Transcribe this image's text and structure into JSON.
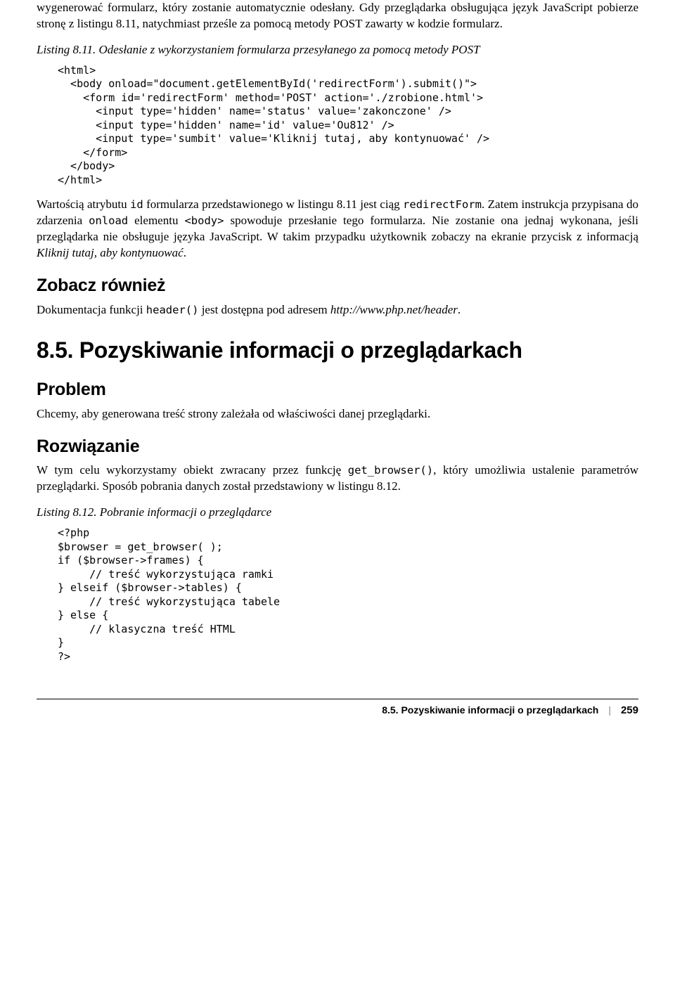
{
  "intro_para": "wygenerować formularz, który zostanie automatycznie odesłany. Gdy przeglądarka obsługująca język JavaScript pobierze stronę z listingu 8.11, natychmiast prześle za pomocą metody POST zawarty w kodzie formularz.",
  "listing_811_caption": "Listing 8.11. Odesłanie z wykorzystaniem formularza przesyłanego za pomocą metody POST",
  "listing_811_code": "<html>\n  <body onload=\"document.getElementById('redirectForm').submit()\">\n    <form id='redirectForm' method='POST' action='./zrobione.html'>\n      <input type='hidden' name='status' value='zakonczone' />\n      <input type='hidden' name='id' value='Ou812' />\n      <input type='sumbit' value='Kliknij tutaj, aby kontynuować' />\n    </form>\n  </body>\n</html>",
  "after_code_para": {
    "t1": "Wartością atrybutu ",
    "c1": "id",
    "t2": " formularza przedstawionego w listingu 8.11 jest ciąg ",
    "c2": "redirectForm",
    "t3": ". Zatem instrukcja przypisana do zdarzenia ",
    "c3": "onload",
    "t4": " elementu ",
    "c4": "<body>",
    "t5": " spowoduje przesłanie tego formularza. Nie zostanie ona jednaj wykonana, jeśli przeglądarka nie obsługuje języka JavaScript. W takim przypadku użytkownik zobaczy na ekranie przycisk z informacją ",
    "i1": "Kliknij tutaj, aby kontynuować",
    "t6": "."
  },
  "see_also_heading": "Zobacz również",
  "see_also_para": {
    "t1": "Dokumentacja funkcji ",
    "c1": "header()",
    "t2": " jest dostępna pod adresem ",
    "i1": "http://www.php.net/header",
    "t3": "."
  },
  "section_85_heading": "8.5. Pozyskiwanie informacji o przeglądarkach",
  "problem_heading": "Problem",
  "problem_para": "Chcemy, aby generowana treść strony zależała od właściwości danej przeglądarki.",
  "solution_heading": "Rozwiązanie",
  "solution_para": {
    "t1": "W tym celu wykorzystamy obiekt zwracany przez funkcję ",
    "c1": "get_browser()",
    "t2": ", który umożliwia ustalenie parametrów przeglądarki. Sposób pobrania danych został przedstawiony w listingu 8.12."
  },
  "listing_812_caption": "Listing 8.12. Pobranie informacji o przeglądarce",
  "listing_812_code": "<?php\n$browser = get_browser( );\nif ($browser->frames) {\n     // treść wykorzystująca ramki\n} elseif ($browser->tables) {\n     // treść wykorzystująca tabele\n} else {\n     // klasyczna treść HTML\n}\n?>",
  "footer": {
    "title": "8.5. Pozyskiwanie informacji o przeglądarkach",
    "sep": "|",
    "page": "259"
  }
}
